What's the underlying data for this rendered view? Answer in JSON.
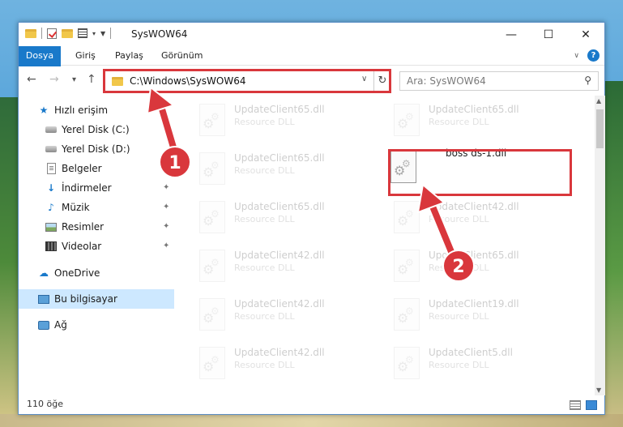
{
  "window": {
    "title": "SysWOW64",
    "minimize": "—",
    "maximize": "☐",
    "close": "✕"
  },
  "ribbon": {
    "tabs": [
      "Dosya",
      "Giriş",
      "Paylaş",
      "Görünüm"
    ]
  },
  "navigation": {
    "back": "←",
    "forward": "→",
    "recent": "▾",
    "up": "↑",
    "address": "C:\\Windows\\SysWOW64",
    "search_placeholder": "Ara: SysWOW64"
  },
  "sidebar": {
    "items": [
      {
        "label": "Hızlı erişim",
        "icon": "star-icon"
      },
      {
        "label": "Yerel Disk (C:)",
        "icon": "disk-icon"
      },
      {
        "label": "Yerel Disk (D:)",
        "icon": "disk-icon"
      },
      {
        "label": "Belgeler",
        "icon": "document-icon"
      },
      {
        "label": "İndirmeler",
        "icon": "download-icon",
        "pinned": true
      },
      {
        "label": "Müzik",
        "icon": "music-icon",
        "pinned": true
      },
      {
        "label": "Resimler",
        "icon": "pictures-icon",
        "pinned": true
      },
      {
        "label": "Videolar",
        "icon": "video-icon",
        "pinned": true
      },
      {
        "label": "OneDrive",
        "icon": "cloud-icon"
      },
      {
        "label": "Bu bilgisayar",
        "icon": "computer-icon",
        "selected": true
      },
      {
        "label": "Ağ",
        "icon": "network-icon"
      }
    ]
  },
  "files": [
    {
      "name": "UpdateClient65.dll",
      "type": "Resource DLL"
    },
    {
      "name": "UpdateClient65.dll",
      "type": "Resource DLL"
    },
    {
      "name": "UpdateClient65.dll",
      "type": "Resource DLL"
    },
    {
      "name": "boss ds-1.dll",
      "type": ""
    },
    {
      "name": "UpdateClient65.dll",
      "type": "Resource DLL"
    },
    {
      "name": "UpdateClient42.dll",
      "type": "Resource DLL"
    },
    {
      "name": "UpdateClient42.dll",
      "type": "Resource DLL"
    },
    {
      "name": "UpdateClient65.dll",
      "type": "Resource DLL"
    },
    {
      "name": "UpdateClient42.dll",
      "type": "Resource DLL"
    },
    {
      "name": "UpdateClient19.dll",
      "type": "Resource DLL"
    },
    {
      "name": "UpdateClient42.dll",
      "type": "Resource DLL"
    },
    {
      "name": "UpdateClient5.dll",
      "type": "Resource DLL"
    }
  ],
  "status": {
    "item_count": "110 öğe"
  },
  "annotations": {
    "step1": "1",
    "step2": "2",
    "color": "#d9373c"
  }
}
